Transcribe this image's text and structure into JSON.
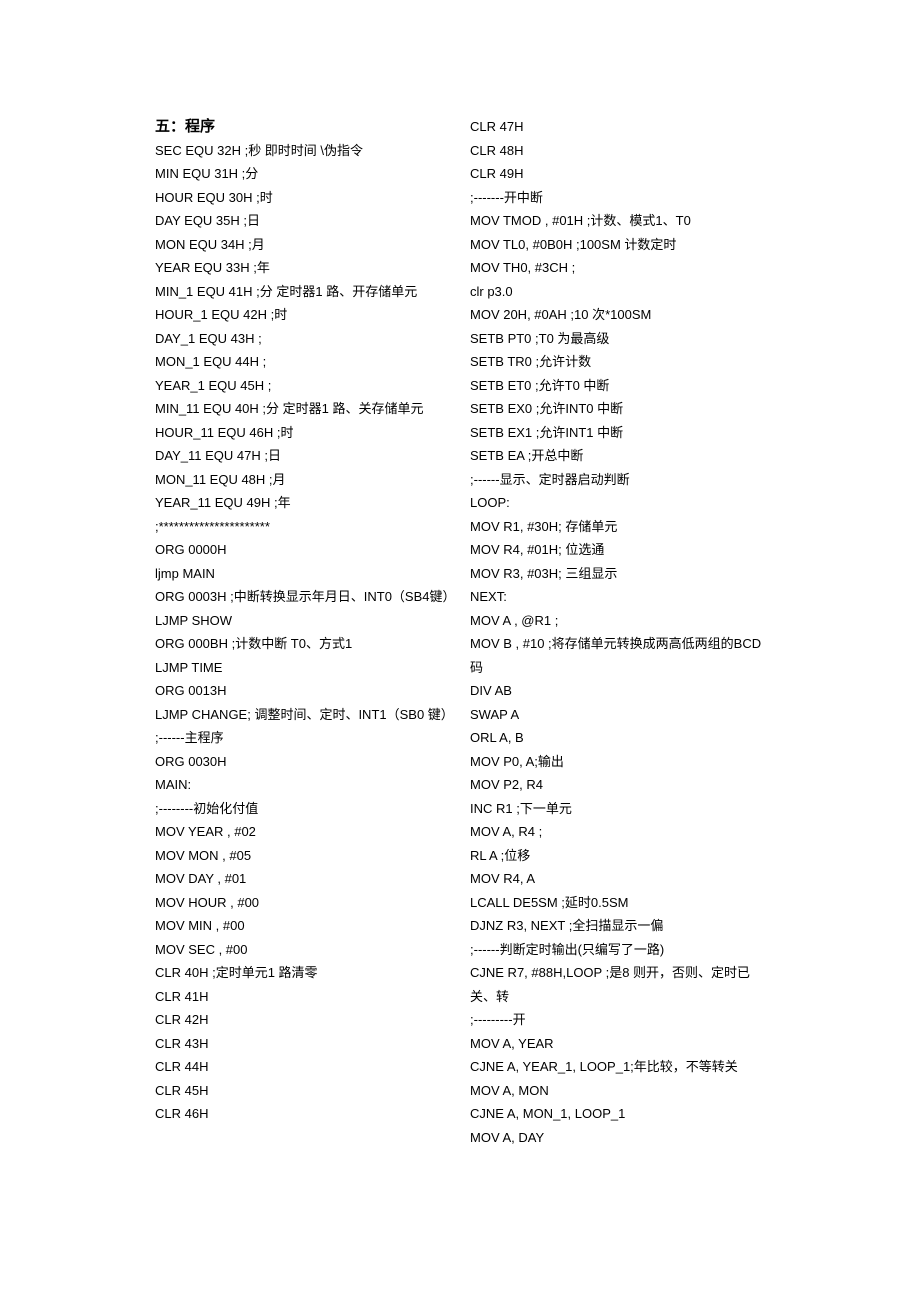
{
  "heading": "五：程序",
  "left_lines": [
    "SEC EQU 32H ;秒 即时时间 \\伪指令",
    "MIN EQU 31H ;分",
    "HOUR EQU 30H ;时",
    "DAY EQU 35H ;日",
    "MON EQU 34H ;月",
    "YEAR EQU 33H ;年",
    "MIN_1 EQU 41H ;分 定时器1 路、开存储单元",
    "HOUR_1 EQU 42H ;时",
    "DAY_1 EQU 43H ;",
    "MON_1 EQU 44H ;",
    "YEAR_1 EQU 45H ;",
    "MIN_11 EQU 40H ;分 定时器1 路、关存储单元",
    "HOUR_11 EQU 46H ;时",
    "DAY_11 EQU 47H ;日",
    "MON_11 EQU 48H ;月",
    "YEAR_11 EQU 49H ;年",
    ";**********************",
    "ORG 0000H",
    "ljmp MAIN",
    "ORG 0003H ;中断转换显示年月日、INT0（SB4键）",
    "LJMP SHOW",
    "ORG 000BH ;计数中断 T0、方式1",
    "LJMP TIME",
    "ORG 0013H",
    "LJMP CHANGE; 调整时间、定时、INT1（SB0 键）",
    ";------主程序",
    "ORG 0030H",
    "MAIN:",
    ";--------初始化付值",
    "MOV YEAR , #02",
    "MOV MON , #05",
    "MOV DAY , #01",
    "MOV HOUR , #00",
    "MOV MIN , #00",
    "MOV SEC , #00",
    "CLR 40H ;定时单元1 路清零",
    "CLR 41H",
    "CLR 42H",
    "CLR 43H",
    "CLR 44H",
    "CLR 45H",
    "CLR 46H"
  ],
  "right_lines": [
    "CLR 47H",
    "CLR 48H",
    "CLR 49H",
    ";-------开中断",
    "MOV TMOD , #01H ;计数、模式1、T0",
    "MOV TL0, #0B0H ;100SM 计数定时",
    "MOV TH0, #3CH ;",
    "clr p3.0",
    "MOV 20H, #0AH ;10 次*100SM",
    "SETB PT0 ;T0 为最高级",
    "SETB TR0 ;允许计数",
    "SETB ET0 ;允许T0 中断",
    "SETB EX0 ;允许INT0 中断",
    "SETB EX1 ;允许INT1 中断",
    "SETB EA ;开总中断",
    ";------显示、定时器启动判断",
    "LOOP:",
    "MOV R1, #30H; 存储单元",
    "MOV R4, #01H; 位选通",
    "MOV R3, #03H; 三组显示",
    "NEXT:",
    "MOV A , @R1 ;",
    "MOV B , #10 ;将存储单元转换成两高低两组的BCD 码",
    "DIV AB",
    "SWAP A",
    "ORL A, B",
    "MOV P0, A;输出",
    "MOV P2, R4",
    "INC R1 ;下一单元",
    "MOV A, R4 ;",
    "RL A ;位移",
    "MOV R4, A",
    "LCALL DE5SM ;延时0.5SM",
    "DJNZ R3, NEXT ;全扫描显示一偏",
    ";------判断定时输出(只编写了一路)",
    "CJNE R7, #88H,LOOP ;是8 则开，否则、定时已关、转",
    ";---------开",
    "MOV A, YEAR",
    "CJNE A, YEAR_1, LOOP_1;年比较，不等转关",
    "MOV A, MON",
    "CJNE A, MON_1, LOOP_1",
    "MOV A, DAY"
  ]
}
